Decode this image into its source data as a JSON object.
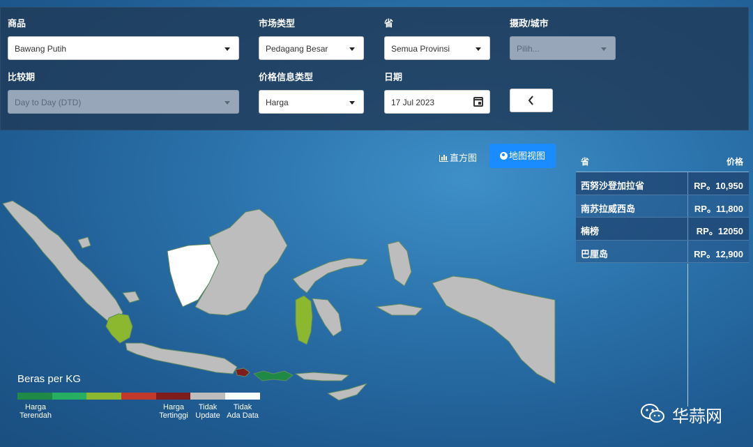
{
  "filters": {
    "commodity": {
      "label": "商品",
      "value": "Bawang Putih"
    },
    "market_type": {
      "label": "市场类型",
      "value": "Pedagang Besar"
    },
    "province": {
      "label": "省",
      "value": "Semua Provinsi"
    },
    "regency": {
      "label": "摄政/城市",
      "placeholder": "Pilih..."
    },
    "comparison": {
      "label": "比较期",
      "value": "Day to Day (DTD)"
    },
    "price_info_type": {
      "label": "价格信息类型",
      "value": "Harga"
    },
    "date": {
      "label": "日期",
      "value": "17 Jul 2023"
    },
    "back_icon": "chevron-left-icon"
  },
  "view": {
    "histogram_label": "直方图",
    "map_label": "地图视图",
    "active": "map"
  },
  "price_table": {
    "headers": {
      "province": "省",
      "price": "价格"
    },
    "rows": [
      {
        "province": "西努沙登加拉省",
        "price": "RP。10,950"
      },
      {
        "province": "南苏拉威西岛",
        "price": "RP。11,800"
      },
      {
        "province": "楠榜",
        "price": "RP。12050"
      },
      {
        "province": "巴厘岛",
        "price": "RP。12,900"
      }
    ]
  },
  "legend": {
    "title": "Beras per KG",
    "colors": [
      "#1f8a45",
      "#27ae60",
      "#8cb82f",
      "#c0392b",
      "#7f1d1d",
      "#bdbdbd",
      "#ffffff"
    ],
    "labels": [
      {
        "text": "Harga\nTerendah"
      },
      {
        "text": "Harga\nTertinggi"
      },
      {
        "text": "Tidak\nUpdate"
      },
      {
        "text": "Tidak\nAda Data"
      }
    ]
  },
  "map_colors": {
    "no_update": "#bdbdbd",
    "no_data": "#ffffff",
    "lampung": "#8cb82f",
    "sulsel": "#8cb82f",
    "bali": "#7f1d1d",
    "ntb": "#1f8a45",
    "ntb_light": "#27ae60"
  },
  "watermark": {
    "text": "华蒜网"
  }
}
